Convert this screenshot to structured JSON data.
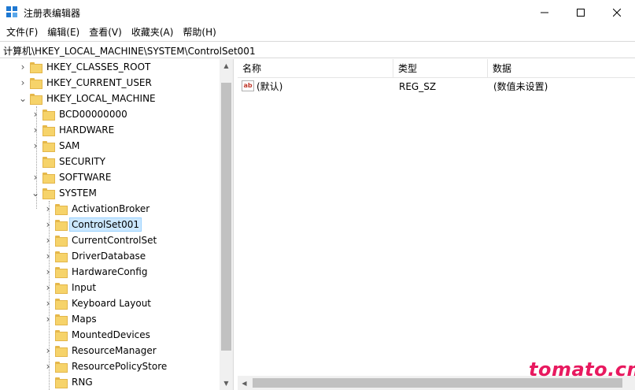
{
  "window": {
    "title": "注册表编辑器",
    "icon": "registry-editor-icon",
    "controls": {
      "minimize": "—",
      "maximize": "☐",
      "close": "✕"
    }
  },
  "menu": [
    {
      "label": "文件(F)"
    },
    {
      "label": "编辑(E)"
    },
    {
      "label": "查看(V)"
    },
    {
      "label": "收藏夹(A)"
    },
    {
      "label": "帮助(H)"
    }
  ],
  "address": {
    "path": "计算机\\HKEY_LOCAL_MACHINE\\SYSTEM\\ControlSet001"
  },
  "tree": [
    {
      "label": "HKEY_CLASSES_ROOT",
      "depth": 0,
      "expander": "›"
    },
    {
      "label": "HKEY_CURRENT_USER",
      "depth": 0,
      "expander": "›"
    },
    {
      "label": "HKEY_LOCAL_MACHINE",
      "depth": 0,
      "expander": "⌄"
    },
    {
      "label": "BCD00000000",
      "depth": 1,
      "expander": "›"
    },
    {
      "label": "HARDWARE",
      "depth": 1,
      "expander": "›"
    },
    {
      "label": "SAM",
      "depth": 1,
      "expander": "›"
    },
    {
      "label": "SECURITY",
      "depth": 1,
      "expander": ""
    },
    {
      "label": "SOFTWARE",
      "depth": 1,
      "expander": "›"
    },
    {
      "label": "SYSTEM",
      "depth": 1,
      "expander": "⌄"
    },
    {
      "label": "ActivationBroker",
      "depth": 2,
      "expander": "›"
    },
    {
      "label": "ControlSet001",
      "depth": 2,
      "expander": "›",
      "selected": true
    },
    {
      "label": "CurrentControlSet",
      "depth": 2,
      "expander": "›"
    },
    {
      "label": "DriverDatabase",
      "depth": 2,
      "expander": "›"
    },
    {
      "label": "HardwareConfig",
      "depth": 2,
      "expander": "›"
    },
    {
      "label": "Input",
      "depth": 2,
      "expander": "›"
    },
    {
      "label": "Keyboard Layout",
      "depth": 2,
      "expander": "›"
    },
    {
      "label": "Maps",
      "depth": 2,
      "expander": "›"
    },
    {
      "label": "MountedDevices",
      "depth": 2,
      "expander": ""
    },
    {
      "label": "ResourceManager",
      "depth": 2,
      "expander": "›"
    },
    {
      "label": "ResourcePolicyStore",
      "depth": 2,
      "expander": "›"
    },
    {
      "label": "RNG",
      "depth": 2,
      "expander": ""
    }
  ],
  "list": {
    "columns": {
      "name": "名称",
      "type": "类型",
      "data": "数据"
    },
    "rows": [
      {
        "icon": "ab",
        "name": "(默认)",
        "type": "REG_SZ",
        "data": "(数值未设置)"
      }
    ]
  },
  "scroll": {
    "up": "▲",
    "down": "▼",
    "left": "◀"
  },
  "watermark": "tomato.cm"
}
